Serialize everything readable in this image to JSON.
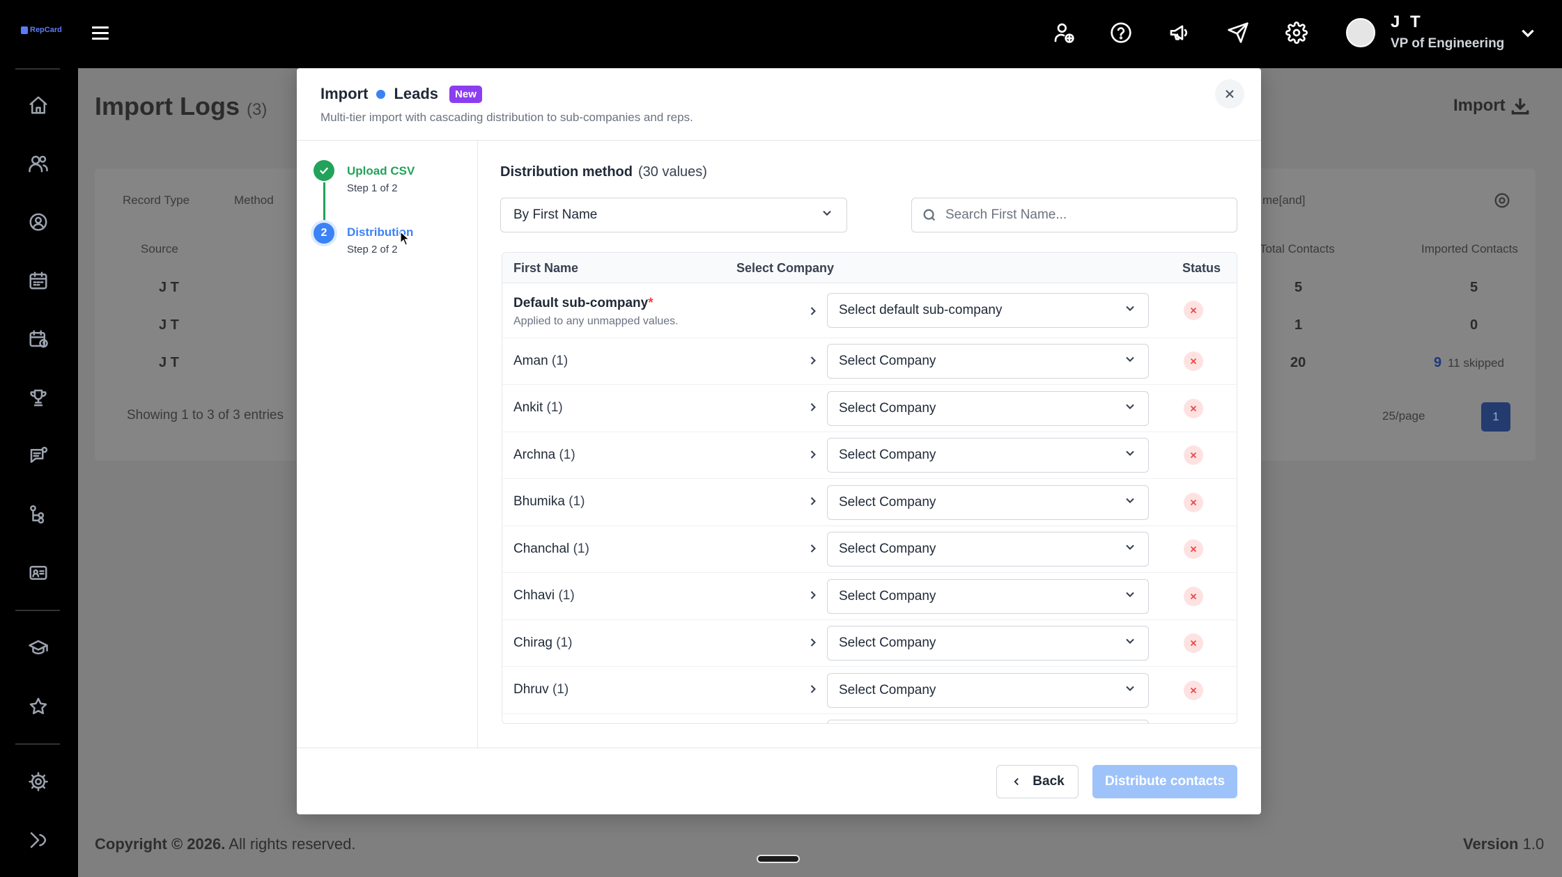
{
  "brand": {
    "logo_text": "RepCard"
  },
  "header": {
    "user_initials": "J T",
    "user_role": "VP of Engineering",
    "icons": [
      "add-user-icon",
      "help-icon",
      "megaphone-icon",
      "send-icon",
      "gear-icon"
    ]
  },
  "background_page": {
    "title": "Import Logs",
    "title_count": "(3)",
    "import_button": "Import",
    "filters": [
      "Record Type",
      "Method"
    ],
    "search_fragment": "me[and]",
    "columns": [
      "Source",
      "Total Contacts",
      "Imported Contacts"
    ],
    "rows": [
      {
        "source": "J T",
        "total": "5",
        "imported": "5",
        "skipped": ""
      },
      {
        "source": "J T",
        "total": "1",
        "imported": "0",
        "skipped": ""
      },
      {
        "source": "J T",
        "total": "20",
        "imported": "9",
        "skipped": "11 skipped"
      }
    ],
    "showing": "Showing 1 to 3 of 3 entries",
    "per_page": "25/page",
    "current_page": "1",
    "footer_copyright": "Copyright © 2026.",
    "footer_rights": "All rights reserved.",
    "footer_version_label": "Version",
    "footer_version": "1.0"
  },
  "modal": {
    "title_import": "Import",
    "title_leads": "Leads",
    "badge": "New",
    "subtitle": "Multi-tier import with cascading distribution to sub-companies and reps.",
    "steps": [
      {
        "label": "Upload CSV",
        "sub": "Step 1 of 2",
        "state": "done"
      },
      {
        "number": "2",
        "label": "Distribution",
        "sub": "Step 2 of 2",
        "state": "active"
      }
    ],
    "distribution_label": "Distribution method",
    "distribution_count": "(30 values)",
    "method_value": "By First Name",
    "search_placeholder": "Search First Name...",
    "table": {
      "headers": {
        "name": "First Name",
        "company": "Select Company",
        "status": "Status"
      },
      "default_row": {
        "name": "Default sub-company",
        "required_mark": "*",
        "note": "Applied to any unmapped values.",
        "select": "Select default sub-company"
      },
      "rows": [
        {
          "name": "Aman",
          "count": "(1)",
          "select": "Select Company"
        },
        {
          "name": "Ankit",
          "count": "(1)",
          "select": "Select Company"
        },
        {
          "name": "Archna",
          "count": "(1)",
          "select": "Select Company"
        },
        {
          "name": "Bhumika",
          "count": "(1)",
          "select": "Select Company"
        },
        {
          "name": "Chanchal",
          "count": "(1)",
          "select": "Select Company"
        },
        {
          "name": "Chhavi",
          "count": "(1)",
          "select": "Select Company"
        },
        {
          "name": "Chirag",
          "count": "(1)",
          "select": "Select Company"
        },
        {
          "name": "Dhruv",
          "count": "(1)",
          "select": "Select Company"
        }
      ]
    },
    "back_button": "Back",
    "distribute_button": "Distribute contacts"
  },
  "colors": {
    "accent_blue": "#3b82f6",
    "success_green": "#22a35a",
    "badge_purple": "#8b3ef0",
    "error_red": "#ef4444",
    "disabled_button": "#9ec3fb"
  }
}
